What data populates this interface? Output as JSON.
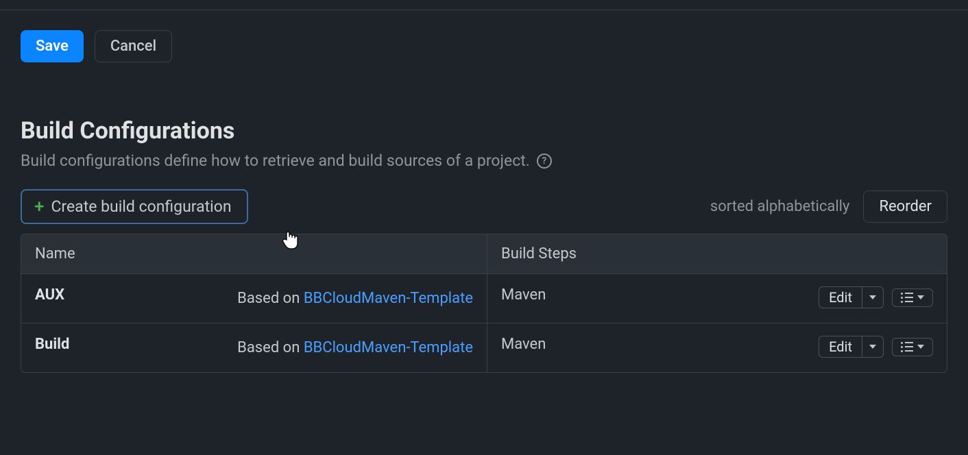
{
  "buttons": {
    "save": "Save",
    "cancel": "Cancel",
    "create_config": "Create build configuration",
    "reorder": "Reorder",
    "edit": "Edit"
  },
  "section": {
    "title": "Build Configurations",
    "description": "Build configurations define how to retrieve and build sources of a project.",
    "sort_label": "sorted alphabetically"
  },
  "table": {
    "headers": {
      "name": "Name",
      "steps": "Build Steps"
    },
    "rows": [
      {
        "name": "AUX",
        "based_on_prefix": "Based on ",
        "template": "BBCloudMaven-Template",
        "steps": "Maven"
      },
      {
        "name": "Build",
        "based_on_prefix": "Based on ",
        "template": "BBCloudMaven-Template",
        "steps": "Maven"
      }
    ]
  }
}
